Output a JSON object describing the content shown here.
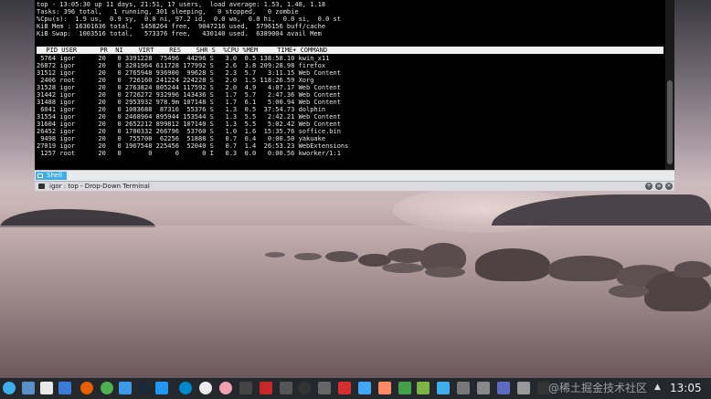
{
  "terminal": {
    "summary_lines": [
      "top - 13:05:30 up 11 days, 21:51, 17 users,  load average: 1.53, 1.48, 1.18",
      "Tasks: 396 total,   1 running, 301 sleeping,   0 stopped,   0 zombie",
      "%Cpu(s):  1.9 us,  0.9 sy,  0.0 ni, 97.2 id,  0.0 wa,  0.0 hi,  0.0 si,  0.0 st",
      "KiB Mem : 16301636 total,  1458264 free,  9047216 used,  5796156 buff/cache",
      "KiB Swap:  1003516 total,   573376 free,   430140 used.  6389004 avail Mem"
    ],
    "process_header": "  PID USER      PR  NI    VIRT    RES    SHR S  %CPU %MEM     TIME+ COMMAND",
    "processes": [
      " 5764 igor      20   0 3391228  75496  44296 S   3.0  0.5 138:58.10 kwin_x11",
      "26872 igor      20   0 3201964 611728 177992 S   2.6  3.8 209:28.98 firefox",
      "31512 igor      20   0 2765948 936900  99628 S   2.3  5.7   3:11.15 Web Content",
      " 2406 root      20   0  726160 241224 224228 S   2.0  1.5 118:26.59 Xorg",
      "31528 igor      20   0 2763824 805244 117592 S   2.0  4.9   4:07.17 Web Content",
      "31442 igor      20   0 2726272 932996 143436 S   1.7  5.7   2:47.36 Web Content",
      "31488 igor      20   0 2953932 978.9m 107148 S   1.7  6.1   5:00.94 Web Content",
      " 6041 igor      20   0 1083688  87316  55376 S   1.3  0.5  37:54.73 dolphin",
      "31554 igor      20   0 2468964 895944 153544 S   1.3  5.5   2:42.21 Web Content",
      "31604 igor      20   0 2652212 899812 107140 S   1.3  5.5   5:02.42 Web Content",
      "26452 igor      20   0 1700332 266796  53760 S   1.0  1.6  15:35.76 soffice.bin",
      " 9498 igor      20   0  755700  62256  51888 S   0.7  0.4   0:00.50 yakuake",
      "27019 igor      20   0 1967548 225456  52040 S   0.7  1.4  26:53.23 WebExtensions",
      " 1257 root      20   0       0      0      0 I   0.3  0.0   0:00.56 kworker/1:1"
    ],
    "tab_label": "Shell",
    "window_title": "igor : top - Drop-Down Terminal"
  },
  "taskbar": {
    "clock": "13:05",
    "watermark": "@稀土掘金技术社区"
  },
  "colors": {
    "accent": "#3daee9",
    "terminal_bg": "#000000",
    "taskbar_bg": "#24272b"
  }
}
